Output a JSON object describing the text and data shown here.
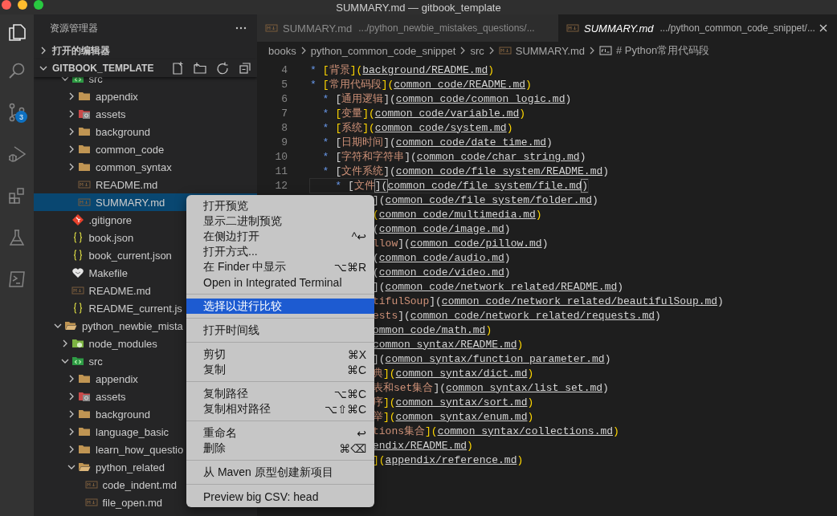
{
  "window": {
    "title": "SUMMARY.md — gitbook_template"
  },
  "activity_bar": [
    {
      "kind": "files",
      "selected": true
    },
    {
      "kind": "search",
      "selected": false
    },
    {
      "kind": "source-control",
      "selected": false,
      "badge": "3"
    },
    {
      "kind": "debug",
      "selected": false
    },
    {
      "kind": "extensions",
      "selected": false
    },
    {
      "kind": "flask",
      "selected": false
    },
    {
      "kind": "terminal",
      "selected": false
    }
  ],
  "sidebar": {
    "title": "资源管理器",
    "sections": [
      {
        "label": "打开的编辑器",
        "expanded": false
      },
      {
        "label": "GITBOOK_TEMPLATE",
        "expanded": true
      }
    ],
    "tree": [
      {
        "children": [
          {
            "label": "src",
            "kind": "folder-src",
            "expanded": true,
            "selected": false,
            "children": [
              {
                "label": "appendix",
                "kind": "folder",
                "expanded": false,
                "selected": false
              },
              {
                "label": "assets",
                "kind": "folder-assets",
                "expanded": false,
                "selected": false
              },
              {
                "label": "background",
                "kind": "folder",
                "expanded": false,
                "selected": false
              },
              {
                "label": "common_code",
                "kind": "folder",
                "expanded": false,
                "selected": false
              },
              {
                "label": "common_syntax",
                "kind": "folder",
                "expanded": false,
                "selected": false
              },
              {
                "label": "README.md",
                "kind": "markdown",
                "selected": false
              },
              {
                "label": "SUMMARY.md",
                "kind": "markdown",
                "selected": true
              }
            ]
          },
          {
            "label": ".gitignore",
            "kind": "git",
            "selected": false
          },
          {
            "label": "book.json",
            "kind": "json",
            "selected": false
          },
          {
            "label": "book_current.json",
            "kind": "json",
            "selected": false
          },
          {
            "label": "Makefile",
            "kind": "make",
            "selected": false
          },
          {
            "label": "README.md",
            "kind": "markdown",
            "selected": false
          },
          {
            "label": "README_current.js",
            "kind": "json",
            "selected": false
          }
        ]
      },
      {
        "label": "python_newbie_mista",
        "kind": "folder",
        "expanded": true,
        "selected": false,
        "children": [
          {
            "label": "node_modules",
            "kind": "folder-node",
            "expanded": false,
            "selected": false
          },
          {
            "label": "src",
            "kind": "folder-src",
            "expanded": true,
            "selected": false,
            "children": [
              {
                "label": "appendix",
                "kind": "folder",
                "expanded": false,
                "selected": false
              },
              {
                "label": "assets",
                "kind": "folder-assets",
                "expanded": false,
                "selected": false
              },
              {
                "label": "background",
                "kind": "folder",
                "expanded": false,
                "selected": false
              },
              {
                "label": "language_basic",
                "kind": "folder",
                "expanded": false,
                "selected": false
              },
              {
                "label": "learn_how_questio",
                "kind": "folder",
                "expanded": false,
                "selected": false
              },
              {
                "label": "python_related",
                "kind": "folder",
                "expanded": true,
                "selected": false,
                "children": [
                  {
                    "label": "code_indent.md",
                    "kind": "markdown",
                    "selected": false
                  },
                  {
                    "label": "file_open.md",
                    "kind": "markdown",
                    "selected": false
                  }
                ]
              }
            ]
          }
        ]
      }
    ]
  },
  "tabs": [
    {
      "name": "SUMMARY.md",
      "path": ".../python_newbie_mistakes_questions/...",
      "selected": false,
      "preview": false
    },
    {
      "name": "SUMMARY.md",
      "path": ".../python_common_code_snippet/...",
      "selected": true,
      "preview": true
    }
  ],
  "breadcrumbs": [
    {
      "text": "books"
    },
    {
      "text": "python_common_code_snippet"
    },
    {
      "text": "src"
    },
    {
      "text": "SUMMARY.md",
      "kind": "markdown"
    },
    {
      "text": "# Python常用代码段",
      "kind": "symbol"
    }
  ],
  "editor": {
    "lines": [
      {
        "number": "4",
        "bullet": "*",
        "open": "[",
        "label": "背景",
        "mid": "](",
        "link": "background/README.md",
        "close": ")",
        "kind": "gold"
      },
      {
        "number": "5",
        "bullet": "*",
        "open": "[",
        "label": "常用代码段",
        "mid": "](",
        "link": "common_code/README.md",
        "close": ")",
        "kind": "gold",
        "children": [
          {
            "number": "6",
            "bullet": "*",
            "open": "[",
            "label": "通用逻辑",
            "mid": "](",
            "link": "common_code/common_logic.md",
            "close": ")",
            "kind": "plain"
          },
          {
            "number": "7",
            "bullet": "*",
            "open": "[",
            "label": "变量",
            "mid": "](",
            "link": "common_code/variable.md",
            "close": ")",
            "kind": "gold"
          },
          {
            "number": "8",
            "bullet": "*",
            "open": "[",
            "label": "系统",
            "mid": "](",
            "link": "common_code/system.md",
            "close": ")",
            "kind": "gold"
          },
          {
            "number": "9",
            "bullet": "*",
            "open": "[",
            "label": "日期时间",
            "mid": "](",
            "link": "common_code/date_time.md",
            "close": ")",
            "kind": "plain"
          },
          {
            "number": "10",
            "bullet": "*",
            "open": "[",
            "label": "字符和字符串",
            "mid": "](",
            "link": "common_code/char_string.md",
            "close": ")",
            "kind": "plain"
          },
          {
            "number": "11",
            "bullet": "*",
            "open": "[",
            "label": "文件系统",
            "mid": "](",
            "link": "common_code/file_system/README.md",
            "close": ")",
            "kind": "plain",
            "children": [
              {
                "number": "12",
                "bullet": "*",
                "open": "[",
                "label": "文件",
                "mid": "](",
                "link": "common_code/file_system/file.md",
                "close": ")",
                "kind": "plain",
                "current": true
              }
            ]
          }
        ]
      },
      {
        "mid": "](",
        "link": "common_code/file_system/folder.md",
        "close": ")",
        "kind": "plain",
        "covered": true
      },
      {
        "mid": "(",
        "link": "common_code/multimedia.md",
        "close": ")",
        "kind": "gold",
        "covered": true
      },
      {
        "mid": "(",
        "link": "common_code/image.md",
        "close": ")",
        "kind": "plain",
        "covered": true
      },
      {
        "label": "llow",
        "mid": "](",
        "link": "common_code/pillow.md",
        "close": ")",
        "kind": "plain",
        "covered": true
      },
      {
        "mid": "(",
        "link": "common_code/audio.md",
        "close": ")",
        "kind": "plain",
        "covered": true
      },
      {
        "mid": "(",
        "link": "common_code/video.md",
        "close": ")",
        "kind": "plain",
        "covered": true
      },
      {
        "mid": "](",
        "link": "common_code/network_related/README.md",
        "close": ")",
        "kind": "plain",
        "covered": true
      },
      {
        "label": "tifulSoup",
        "mid": "](",
        "link": "common_code/network_related/beautifulSoup.md",
        "close": ")",
        "kind": "plain",
        "covered": true
      },
      {
        "label": "ests",
        "mid": "](",
        "link": "common_code/network_related/requests.md",
        "close": ")",
        "kind": "plain",
        "covered": true
      },
      {
        "link": "ommon_code/math.md",
        "close": ")",
        "kind": "gold",
        "covered": true
      },
      {
        "link": "common_syntax/README.md",
        "close": ")",
        "kind": "gold",
        "covered": true
      },
      {
        "mid": "](",
        "link": "common_syntax/function_parameter.md",
        "close": ")",
        "kind": "plain",
        "covered": true
      },
      {
        "label": "典",
        "mid": "](",
        "link": "common_syntax/dict.md",
        "close": ")",
        "kind": "gold",
        "covered": true
      },
      {
        "label": "表和set集合",
        "mid": "](",
        "link": "common_syntax/list_set.md",
        "close": ")",
        "kind": "plain",
        "covered": true
      },
      {
        "label": "序",
        "mid": "](",
        "link": "common_syntax/sort.md",
        "close": ")",
        "kind": "gold",
        "covered": true
      },
      {
        "label": "举",
        "mid": "](",
        "link": "common_syntax/enum.md",
        "close": ")",
        "kind": "gold",
        "covered": true
      },
      {
        "label": "tions集合",
        "mid": "](",
        "link": "common_syntax/collections.md",
        "close": ")",
        "kind": "gold",
        "covered": true
      },
      {
        "link": "endix/README.md",
        "close": ")",
        "kind": "gold",
        "covered": true
      },
      {
        "mid": "](",
        "link": "appendix/reference.md",
        "close": ")",
        "kind": "gold",
        "covered": true
      }
    ]
  },
  "context_menu": {
    "groups": [
      [
        {
          "label": "打开预览",
          "selected": false
        },
        {
          "label": "显示二进制预览",
          "selected": false
        },
        {
          "label": "在侧边打开",
          "shortcut": "^↩",
          "selected": false
        },
        {
          "label": "打开方式...",
          "selected": false
        },
        {
          "label": "在 Finder 中显示",
          "shortcut": "⌥⌘R",
          "selected": false
        },
        {
          "label": "Open in Integrated Terminal",
          "selected": false
        }
      ],
      [
        {
          "label": "选择以进行比较",
          "selected": true
        }
      ],
      [
        {
          "label": "打开时间线",
          "selected": false
        }
      ],
      [
        {
          "label": "剪切",
          "shortcut": "⌘X",
          "selected": false
        },
        {
          "label": "复制",
          "shortcut": "⌘C",
          "selected": false
        }
      ],
      [
        {
          "label": "复制路径",
          "shortcut": "⌥⌘C",
          "selected": false
        },
        {
          "label": "复制相对路径",
          "shortcut": "⌥⇧⌘C",
          "selected": false
        }
      ],
      [
        {
          "label": "重命名",
          "shortcut": "↩",
          "selected": false
        },
        {
          "label": "删除",
          "shortcut": "⌘⌫",
          "selected": false
        }
      ],
      [
        {
          "label": "从 Maven 原型创建新项目",
          "selected": false
        }
      ],
      [
        {
          "label": "Preview big CSV: head",
          "selected": false
        }
      ]
    ]
  }
}
